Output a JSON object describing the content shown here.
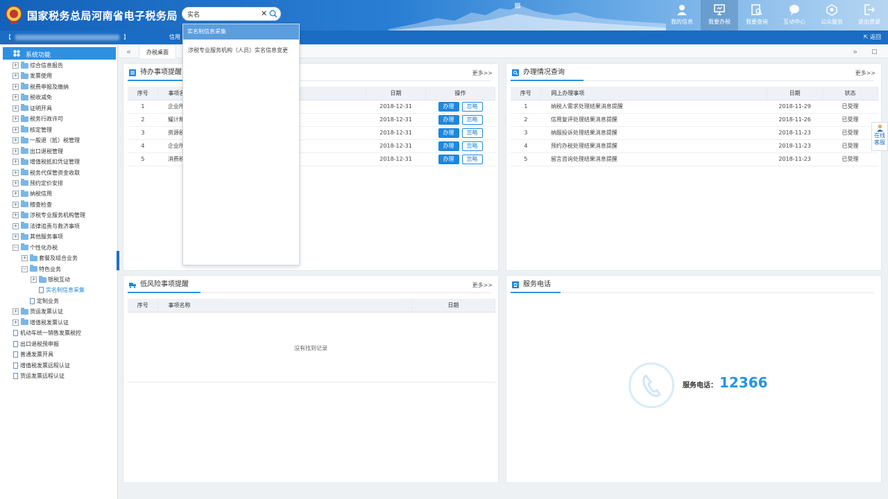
{
  "header": {
    "site_title": "国家税务总局河南省电子税务局",
    "search": {
      "value": "实名",
      "placeholder": ""
    },
    "nav": [
      {
        "label": "我的信息",
        "icon": "user-icon"
      },
      {
        "label": "我要办税",
        "icon": "monitor-icon",
        "active": true
      },
      {
        "label": "我要查询",
        "icon": "query-icon"
      },
      {
        "label": "互动中心",
        "icon": "chat-icon"
      },
      {
        "label": "公众服务",
        "icon": "service-icon"
      },
      {
        "label": "退出登录",
        "icon": "logout-icon"
      }
    ]
  },
  "subbar": {
    "taxpayer_prefix": "【",
    "taxpayer_suffix": "】",
    "credit": "信用",
    "back": "返回"
  },
  "sidebar": {
    "title": "系统功能",
    "items": [
      {
        "label": "综合信息报告",
        "level": 0,
        "type": "folder",
        "toggle": "+"
      },
      {
        "label": "发票使用",
        "level": 0,
        "type": "folder",
        "toggle": "+"
      },
      {
        "label": "税费申报及缴纳",
        "level": 0,
        "type": "folder",
        "toggle": "+"
      },
      {
        "label": "税收减免",
        "level": 0,
        "type": "folder",
        "toggle": "+"
      },
      {
        "label": "证明开具",
        "level": 0,
        "type": "folder",
        "toggle": "+"
      },
      {
        "label": "税务行政许可",
        "level": 0,
        "type": "folder",
        "toggle": "+"
      },
      {
        "label": "核定管理",
        "level": 0,
        "type": "folder",
        "toggle": "+"
      },
      {
        "label": "一般退（抵）税管理",
        "level": 0,
        "type": "folder",
        "toggle": "+"
      },
      {
        "label": "出口退税管理",
        "level": 0,
        "type": "folder",
        "toggle": "+"
      },
      {
        "label": "增值税抵扣凭证管理",
        "level": 0,
        "type": "folder",
        "toggle": "+"
      },
      {
        "label": "税务代保管资金收取",
        "level": 0,
        "type": "folder",
        "toggle": "+"
      },
      {
        "label": "预约定价安排",
        "level": 0,
        "type": "folder",
        "toggle": "+"
      },
      {
        "label": "纳税信用",
        "level": 0,
        "type": "folder",
        "toggle": "+"
      },
      {
        "label": "稽查检查",
        "level": 0,
        "type": "folder",
        "toggle": "+"
      },
      {
        "label": "涉税专业服务机构管理",
        "level": 0,
        "type": "folder",
        "toggle": "+"
      },
      {
        "label": "法律追责与救济事项",
        "level": 0,
        "type": "folder",
        "toggle": "+"
      },
      {
        "label": "其他服务事项",
        "level": 0,
        "type": "folder",
        "toggle": "+"
      },
      {
        "label": "个性化办税",
        "level": 0,
        "type": "folder",
        "toggle": "−"
      },
      {
        "label": "套餐及组合业务",
        "level": 1,
        "type": "folder",
        "toggle": "+"
      },
      {
        "label": "特色业务",
        "level": 1,
        "type": "folder",
        "toggle": "−"
      },
      {
        "label": "银税互动",
        "level": 2,
        "type": "folder",
        "toggle": "+"
      },
      {
        "label": "实名制信息采集",
        "level": 2,
        "type": "doc",
        "toggle": "",
        "selected": true
      },
      {
        "label": "定制业务",
        "level": 1,
        "type": "doc",
        "toggle": ""
      },
      {
        "label": "货运发票认证",
        "level": 0,
        "type": "folder",
        "toggle": "+"
      },
      {
        "label": "增值税发票认证",
        "level": 0,
        "type": "folder",
        "toggle": "+"
      },
      {
        "label": "机动车统一销售发票税控",
        "level": -1,
        "type": "doc",
        "toggle": ""
      },
      {
        "label": "出口退税预申报",
        "level": -1,
        "type": "doc",
        "toggle": ""
      },
      {
        "label": "普通发票开具",
        "level": -1,
        "type": "doc",
        "toggle": ""
      },
      {
        "label": "增值税发票远程认证",
        "level": -1,
        "type": "doc",
        "toggle": ""
      },
      {
        "label": "货运发票远程认证",
        "level": -1,
        "type": "doc",
        "toggle": ""
      }
    ]
  },
  "tabbar": {
    "tab": "办税桌面",
    "left": "«",
    "right": "»"
  },
  "dropdown": {
    "highlight": "实名制信息采集",
    "item": "涉税专业服务机构（人员）实名信息变更"
  },
  "todo_panel": {
    "title": "待办事项提醒",
    "more": "更多>>",
    "columns": [
      "序号",
      "事项名称",
      "日期",
      "操作"
    ],
    "rows": [
      {
        "no": "1",
        "name": "企业所",
        "date": "2018-12-31"
      },
      {
        "no": "2",
        "name": "耀计和",
        "date": "2018-12-31"
      },
      {
        "no": "3",
        "name": "资源税",
        "date": "2018-12-31"
      },
      {
        "no": "4",
        "name": "企业所",
        "date": "2018-12-31"
      },
      {
        "no": "5",
        "name": "消费税",
        "date": "2018-12-31"
      }
    ],
    "btn_do": "办理",
    "btn_ignore": "忽略"
  },
  "progress_panel": {
    "title": "办理情况查询",
    "more": "更多>>",
    "columns": [
      "序号",
      "网上办理事项",
      "日期",
      "状态"
    ],
    "rows": [
      {
        "no": "1",
        "name": "纳税人需求处理结果消息提醒",
        "date": "2018-11-29",
        "status": "已受理"
      },
      {
        "no": "2",
        "name": "信用复评处理结果消息提醒",
        "date": "2018-11-26",
        "status": "已受理"
      },
      {
        "no": "3",
        "name": "纳服投诉处理结果消息提醒",
        "date": "2018-11-23",
        "status": "已受理"
      },
      {
        "no": "4",
        "name": "预约办税处理结果消息提醒",
        "date": "2018-11-23",
        "status": "已受理"
      },
      {
        "no": "5",
        "name": "留言咨询处理结果消息提醒",
        "date": "2018-11-23",
        "status": "已受理"
      }
    ]
  },
  "risk_panel": {
    "title": "低风险事项提醒",
    "more": "更多>>",
    "columns": [
      "序号",
      "事项名称",
      "日期"
    ],
    "empty": "没有找到记录"
  },
  "phone_panel": {
    "title": "服务电话",
    "label": "服务电话：",
    "number": "12366"
  },
  "side_float": {
    "line1": "在线",
    "line2": "客服"
  },
  "colors": {
    "primary": "#1e87de",
    "header_dark": "#1461ba",
    "accent_number": "#2496df"
  }
}
